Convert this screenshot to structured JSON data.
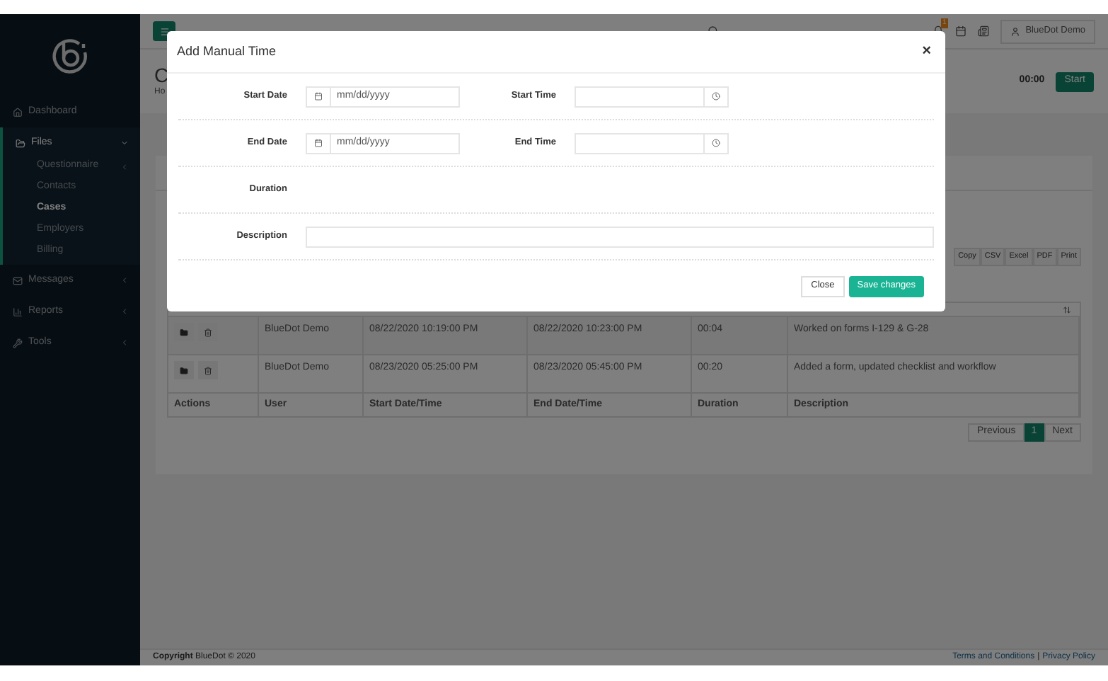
{
  "sidebar": {
    "items": [
      {
        "label": "Dashboard",
        "kind": "link",
        "expanded": false
      },
      {
        "label": "Files",
        "kind": "folder",
        "expanded": true,
        "children": [
          {
            "label": "Questionnaire",
            "selected": false,
            "submenu": true
          },
          {
            "label": "Contacts",
            "selected": false,
            "submenu": false
          },
          {
            "label": "Cases",
            "selected": true,
            "submenu": false
          },
          {
            "label": "Employers",
            "selected": false,
            "submenu": false
          },
          {
            "label": "Billing",
            "selected": false,
            "submenu": false
          }
        ]
      },
      {
        "label": "Messages",
        "kind": "mail",
        "expanded": false
      },
      {
        "label": "Reports",
        "kind": "chart",
        "expanded": false
      },
      {
        "label": "Tools",
        "kind": "wrench",
        "expanded": false
      }
    ]
  },
  "topbar": {
    "notifications": "1",
    "user": "BlueDot Demo"
  },
  "page": {
    "title": "C",
    "breadcrumb": "Ho",
    "timer": "00:00",
    "start": "Start"
  },
  "exports": [
    "Copy",
    "CSV",
    "Excel",
    "PDF",
    "Print"
  ],
  "table": {
    "columns": [
      "Actions",
      "User",
      "Start Date/Time",
      "End Date/Time",
      "Duration",
      "Description"
    ],
    "rows": [
      {
        "user": "BlueDot Demo",
        "start": "08/22/2020 10:19:00 PM",
        "end": "08/22/2020 10:23:00 PM",
        "duration": "00:04",
        "description": "Worked on forms I-129 & G-28"
      },
      {
        "user": "BlueDot Demo",
        "start": "08/23/2020 05:25:00 PM",
        "end": "08/23/2020 05:45:00 PM",
        "duration": "00:20",
        "description": "Added a form, updated checklist and workflow"
      }
    ]
  },
  "pagination": {
    "previous": "Previous",
    "pages": [
      {
        "label": "1",
        "selected": true
      }
    ],
    "next": "Next"
  },
  "footer": {
    "copyright": "**Copyright** BlueDot © 2020",
    "links": [
      "Terms and Conditions",
      "Privacy Policy"
    ],
    "separator": "|"
  },
  "modal": {
    "title": "Add Manual Time",
    "close": "×",
    "rows": [
      {
        "fields": [
          {
            "label": "Start Date",
            "kind": "date",
            "placeholder": "mm/dd/yyyy"
          },
          {
            "label": "Start Time",
            "kind": "time"
          }
        ]
      },
      {
        "fields": [
          {
            "label": "End Date",
            "kind": "date",
            "placeholder": "mm/dd/yyyy"
          },
          {
            "label": "End Time",
            "kind": "time"
          }
        ]
      },
      {
        "fields": [
          {
            "label": "Duration",
            "kind": "display"
          }
        ]
      },
      {
        "fields": [
          {
            "label": "Description",
            "kind": "text"
          }
        ]
      }
    ],
    "buttons": [
      "Close",
      "Save changes"
    ]
  }
}
